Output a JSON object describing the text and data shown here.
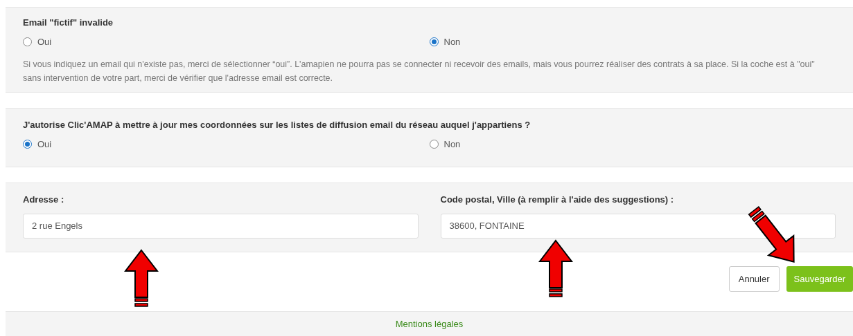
{
  "email_fictif": {
    "title": "Email \"fictif\" invalide",
    "options": [
      {
        "label": "Oui",
        "selected": false
      },
      {
        "label": "Non",
        "selected": true
      }
    ],
    "help": "Si vous indiquez un email qui n'existe pas, merci de sélectionner “oui”. L'amapien ne pourra pas se connecter ni recevoir des emails, mais vous pourrez réaliser des contrats à sa place. Si la coche est à \"oui\" sans intervention de votre part, merci de vérifier que l'adresse email est correcte."
  },
  "autorisation": {
    "title": "J'autorise Clic'AMAP à mettre à jour mes coordonnées sur les listes de diffusion email du réseau auquel j'appartiens ?",
    "options": [
      {
        "label": "Oui",
        "selected": true
      },
      {
        "label": "Non",
        "selected": false
      }
    ]
  },
  "address": {
    "fields": [
      {
        "label": "Adresse :",
        "value": "2 rue Engels"
      },
      {
        "label": "Code postal, Ville (à remplir à l'aide des suggestions) :",
        "value": "38600, FONTAINE"
      }
    ]
  },
  "buttons": {
    "cancel": "Annuler",
    "save": "Sauvegarder"
  },
  "footer": {
    "link": "Mentions légales"
  }
}
